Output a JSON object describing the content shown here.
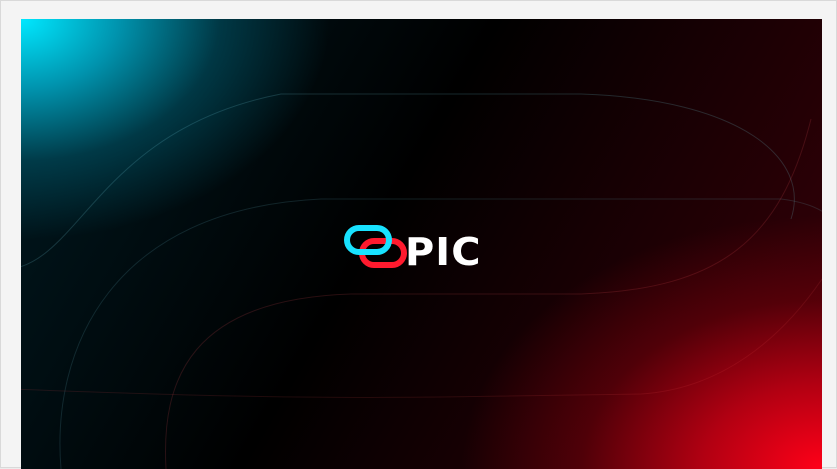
{
  "brand": {
    "name_suffix": "PIC",
    "logo_icon": "chain-link-icon",
    "colors": {
      "cyan": "#00e8ff",
      "red": "#ff1a2e",
      "text": "#ffffff"
    }
  }
}
